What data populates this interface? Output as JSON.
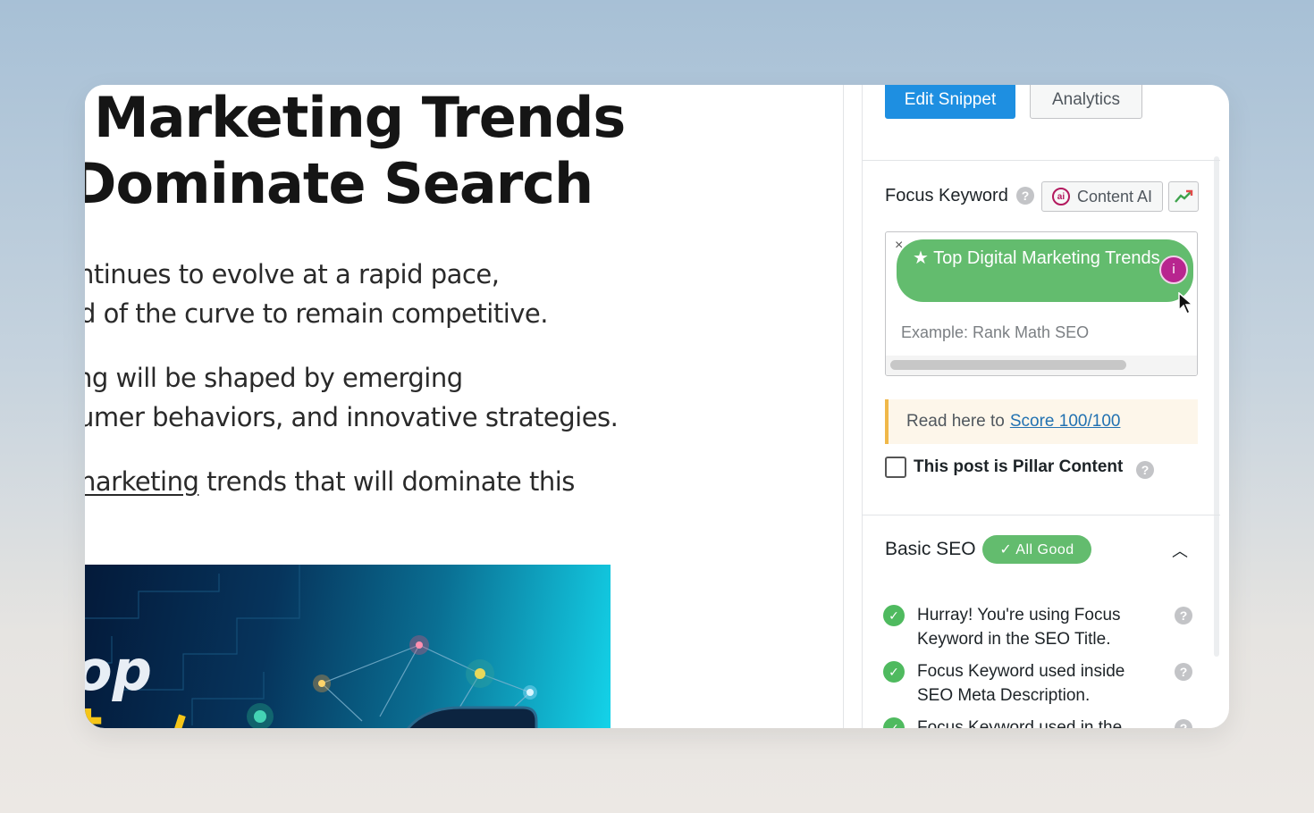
{
  "post": {
    "title_lines": [
      "Marketing Trends",
      "Dominate Search"
    ],
    "paragraphs": [
      {
        "lines": [
          "ntinues to evolve at a rapid pace,",
          "d of the curve to remain competitive."
        ]
      },
      {
        "lines": [
          "ng will be shaped by emerging",
          "umer behaviors, and innovative strategies."
        ]
      },
      {
        "link_text": "narketing",
        "rest_text": " trends that will dominate this"
      }
    ]
  },
  "sidebar": {
    "tabs": {
      "edit_snippet": "Edit Snippet",
      "analytics": "Analytics"
    },
    "focus_keyword": {
      "label": "Focus Keyword",
      "help_icon": "?",
      "content_ai_label": "Content AI",
      "keyword_tag": "★ Top Digital Marketing Trends",
      "remove_icon": "×",
      "info_icon": "i",
      "placeholder": "Example: Rank Math SEO"
    },
    "notice": {
      "prefix": "Read here to",
      "link": "Score 100/100"
    },
    "pillar": {
      "label": "This post is Pillar Content"
    },
    "basic_seo": {
      "title": "Basic SEO",
      "badge": "✓ All Good",
      "chevron": "︿",
      "items": [
        "Hurray! You're using Focus Keyword in the SEO Title.",
        "Focus Keyword used inside SEO Meta Description.",
        "Focus Keyword used in the"
      ]
    }
  },
  "colors": {
    "primary_button": "#1e8fe1",
    "keyword_tag": "#63bc6e",
    "good_badge": "#63bc6e",
    "notice_border": "#f0b849",
    "link": "#2271b1"
  }
}
